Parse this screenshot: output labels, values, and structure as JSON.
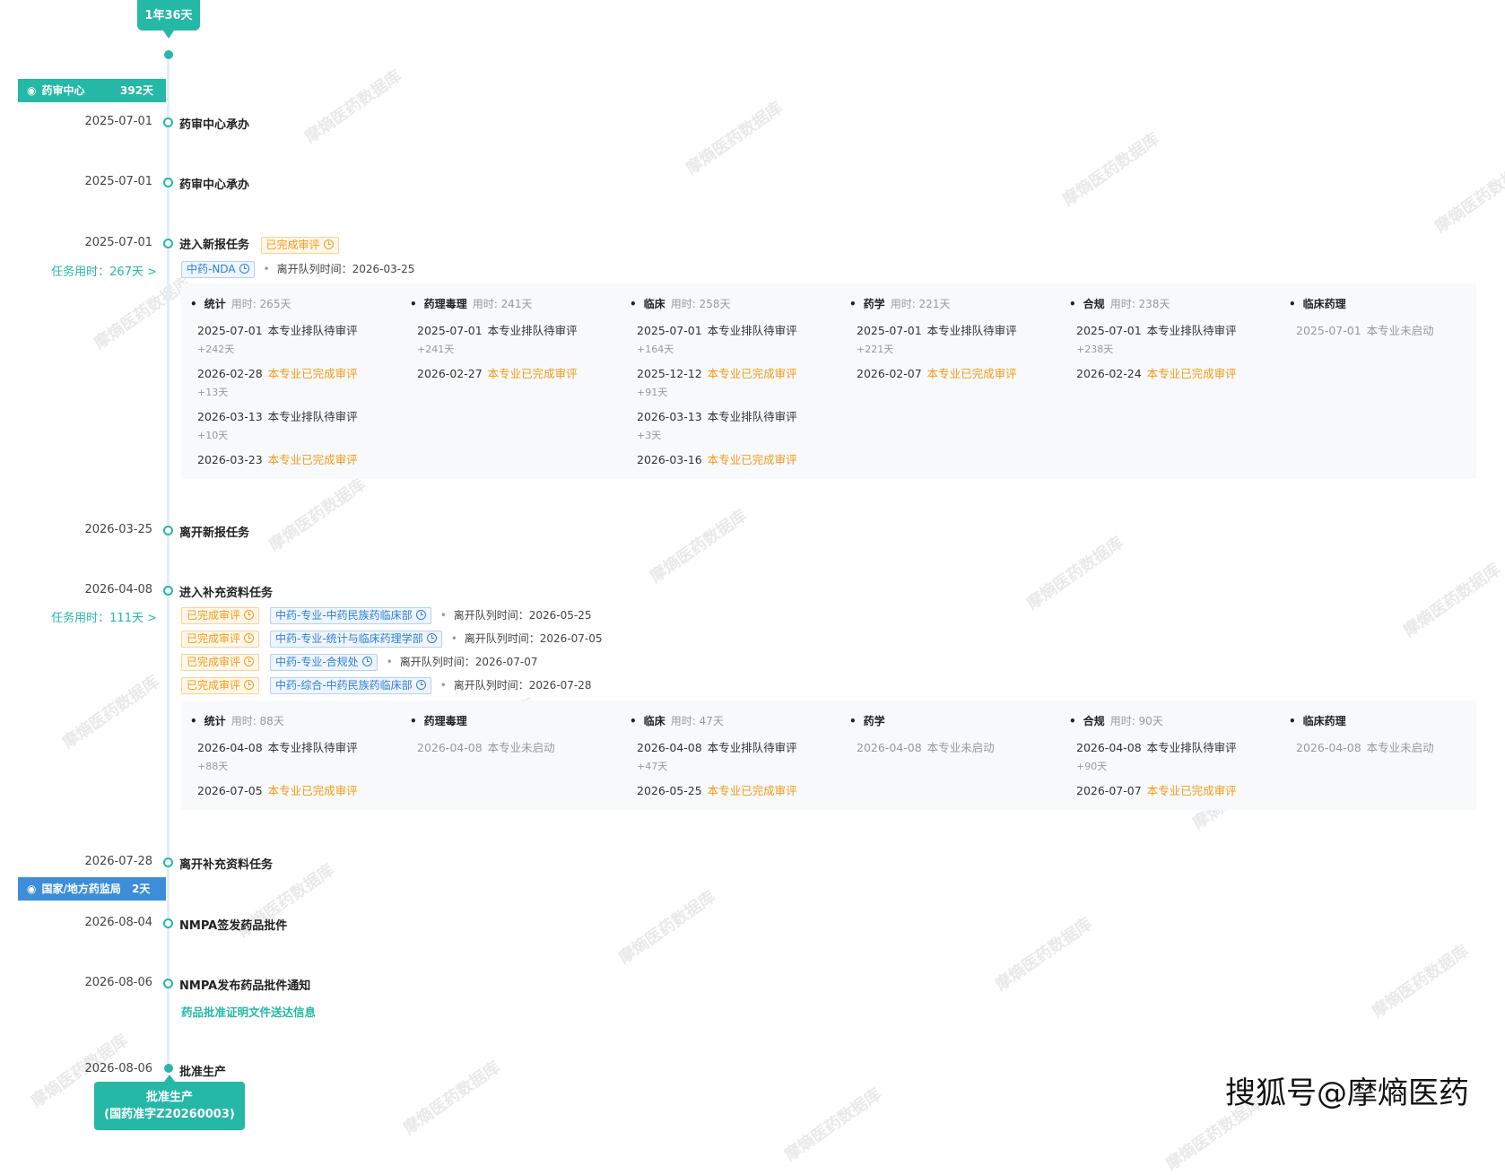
{
  "top_bubble": "1年36天",
  "stages": {
    "cde": {
      "name": "药审中心",
      "days": "392天",
      "color": "#26b8a6"
    },
    "nmpa": {
      "name": "国家/地方药监局",
      "days": "2天",
      "color": "#3d8ed9"
    }
  },
  "events": [
    {
      "date": "2025-07-01",
      "title": "药审中心承办"
    },
    {
      "date": "2025-07-01",
      "title": "药审中心承办"
    },
    {
      "date": "2025-07-01",
      "title": "进入新报任务",
      "tag": "已完成审评"
    },
    {
      "date": "2026-03-25",
      "title": "离开新报任务"
    },
    {
      "date": "2026-04-08",
      "title": "进入补充资料任务"
    },
    {
      "date": "2026-07-28",
      "title": "离开补充资料任务"
    },
    {
      "date": "2026-08-04",
      "title": "NMPA签发药品批件"
    },
    {
      "date": "2026-08-06",
      "title": "NMPA发布药品批件通知"
    },
    {
      "date": "2026-08-06",
      "title": "批准生产"
    }
  ],
  "task1": {
    "time": "任务用时：267天 >",
    "line": {
      "tag": "中药-NDA",
      "leave_label": "离开队列时间：",
      "leave_date": "2026-03-25"
    },
    "columns": [
      {
        "name": "统计",
        "used": "用时: 265天",
        "rows": [
          {
            "date": "2025-07-01",
            "status": "本专业排队待审评"
          },
          {
            "gap": "+242天"
          },
          {
            "date": "2026-02-28",
            "status": "本专业已完成审评",
            "done": true
          },
          {
            "gap": "+13天"
          },
          {
            "date": "2026-03-13",
            "status": "本专业排队待审评"
          },
          {
            "gap": "+10天"
          },
          {
            "date": "2026-03-23",
            "status": "本专业已完成审评",
            "done": true
          }
        ]
      },
      {
        "name": "药理毒理",
        "used": "用时: 241天",
        "rows": [
          {
            "date": "2025-07-01",
            "status": "本专业排队待审评"
          },
          {
            "gap": "+241天"
          },
          {
            "date": "2026-02-27",
            "status": "本专业已完成审评",
            "done": true
          }
        ]
      },
      {
        "name": "临床",
        "used": "用时: 258天",
        "rows": [
          {
            "date": "2025-07-01",
            "status": "本专业排队待审评"
          },
          {
            "gap": "+164天"
          },
          {
            "date": "2025-12-12",
            "status": "本专业已完成审评",
            "done": true
          },
          {
            "gap": "+91天"
          },
          {
            "date": "2026-03-13",
            "status": "本专业排队待审评"
          },
          {
            "gap": "+3天"
          },
          {
            "date": "2026-03-16",
            "status": "本专业已完成审评",
            "done": true
          }
        ]
      },
      {
        "name": "药学",
        "used": "用时: 221天",
        "rows": [
          {
            "date": "2025-07-01",
            "status": "本专业排队待审评"
          },
          {
            "gap": "+221天"
          },
          {
            "date": "2026-02-07",
            "status": "本专业已完成审评",
            "done": true
          }
        ]
      },
      {
        "name": "合规",
        "used": "用时: 238天",
        "rows": [
          {
            "date": "2025-07-01",
            "status": "本专业排队待审评"
          },
          {
            "gap": "+238天"
          },
          {
            "date": "2026-02-24",
            "status": "本专业已完成审评",
            "done": true
          }
        ]
      },
      {
        "name": "临床药理",
        "used": "",
        "rows": [
          {
            "date": "2025-07-01",
            "status": "本专业未启动",
            "gray": true
          }
        ]
      }
    ]
  },
  "task2": {
    "time": "任务用时：111天 >",
    "lines": [
      {
        "status": "已完成审评",
        "dept": "中药-专业-中药民族药临床部",
        "leave_label": "离开队列时间：",
        "leave_date": "2026-05-25"
      },
      {
        "status": "已完成审评",
        "dept": "中药-专业-统计与临床药理学部",
        "leave_label": "离开队列时间：",
        "leave_date": "2026-07-05"
      },
      {
        "status": "已完成审评",
        "dept": "中药-专业-合规处",
        "leave_label": "离开队列时间：",
        "leave_date": "2026-07-07"
      },
      {
        "status": "已完成审评",
        "dept": "中药-综合-中药民族药临床部",
        "leave_label": "离开队列时间：",
        "leave_date": "2026-07-28"
      }
    ],
    "columns": [
      {
        "name": "统计",
        "used": "用时: 88天",
        "rows": [
          {
            "date": "2026-04-08",
            "status": "本专业排队待审评"
          },
          {
            "gap": "+88天"
          },
          {
            "date": "2026-07-05",
            "status": "本专业已完成审评",
            "done": true
          }
        ]
      },
      {
        "name": "药理毒理",
        "used": "",
        "rows": [
          {
            "date": "2026-04-08",
            "status": "本专业未启动",
            "gray": true
          }
        ]
      },
      {
        "name": "临床",
        "used": "用时: 47天",
        "rows": [
          {
            "date": "2026-04-08",
            "status": "本专业排队待审评"
          },
          {
            "gap": "+47天"
          },
          {
            "date": "2026-05-25",
            "status": "本专业已完成审评",
            "done": true
          }
        ]
      },
      {
        "name": "药学",
        "used": "",
        "rows": [
          {
            "date": "2026-04-08",
            "status": "本专业未启动",
            "gray": true
          }
        ]
      },
      {
        "name": "合规",
        "used": "用时: 90天",
        "rows": [
          {
            "date": "2026-04-08",
            "status": "本专业排队待审评"
          },
          {
            "gap": "+90天"
          },
          {
            "date": "2026-07-07",
            "status": "本专业已完成审评",
            "done": true
          }
        ]
      },
      {
        "name": "临床药理",
        "used": "",
        "rows": [
          {
            "date": "2026-04-08",
            "status": "本专业未启动",
            "gray": true
          }
        ]
      }
    ]
  },
  "approval_link": "药品批准证明文件送达信息",
  "final_box": {
    "line1": "批准生产",
    "line2": "(国药准字Z20260003)"
  },
  "watermark": "摩熵医药数据库",
  "footer_credit": "搜狐号@摩熵医药",
  "colors": {
    "accent": "#26b8a6",
    "orange": "#f29b1a",
    "blue": "#3d8ed9"
  }
}
